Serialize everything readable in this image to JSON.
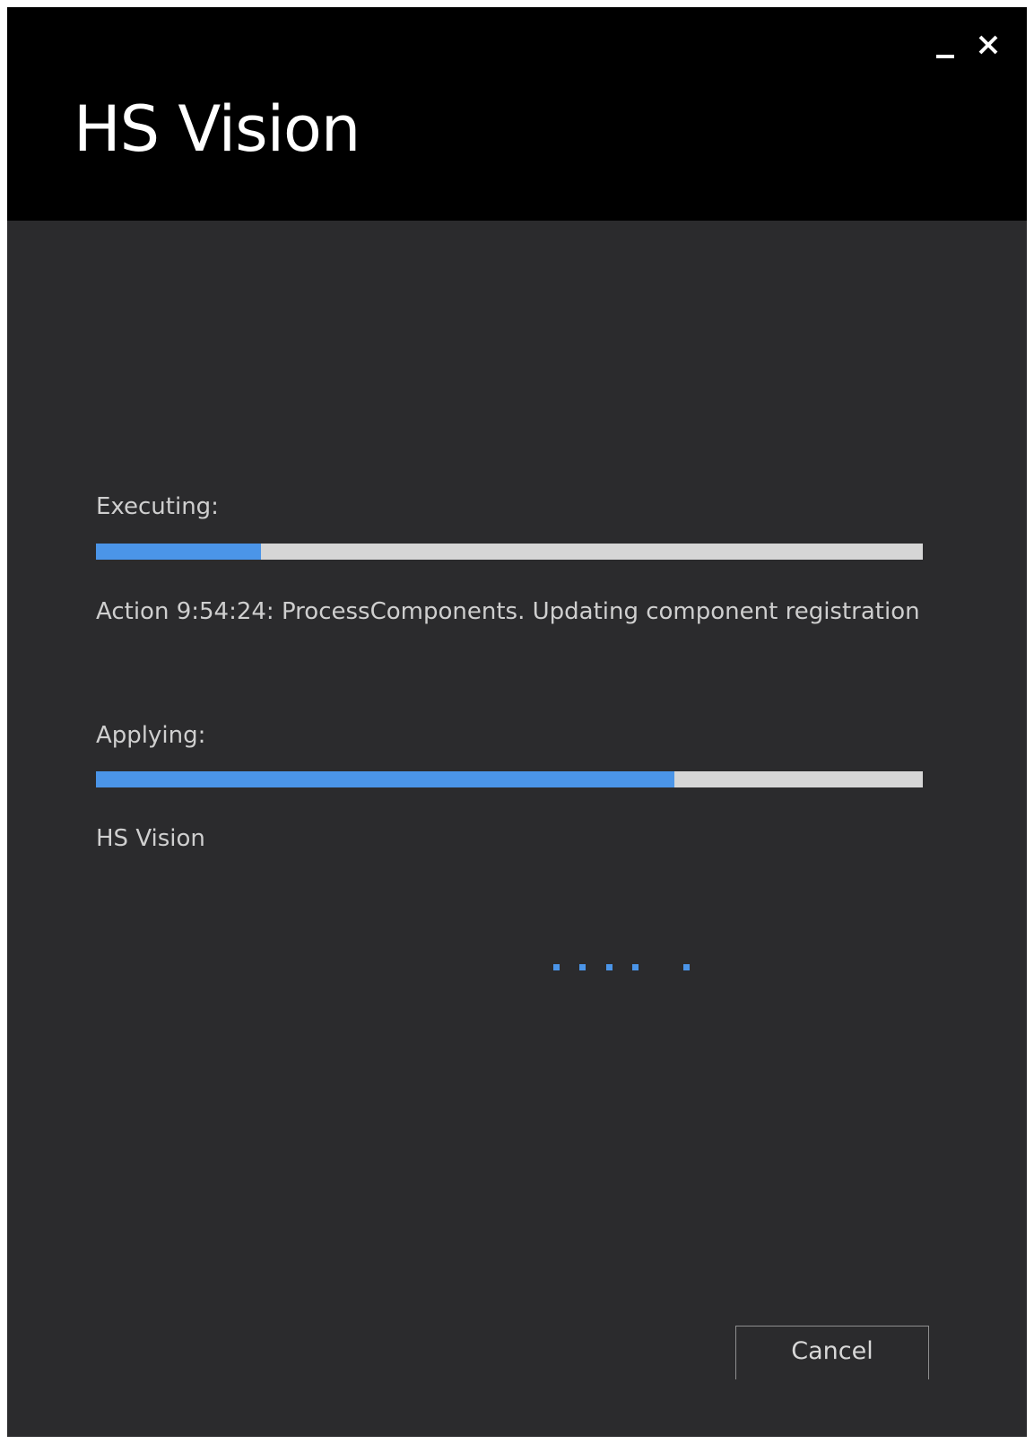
{
  "window": {
    "title": "HS Vision",
    "minimize_icon": "minimize-icon",
    "close_icon": "close-icon"
  },
  "executing": {
    "label": "Executing:",
    "progress_fraction": 0.2,
    "action_text": "Action 9:54:24: ProcessComponents. Updating component registration"
  },
  "applying": {
    "label": "Applying:",
    "progress_fraction": 0.7,
    "detail_text": "HS Vision"
  },
  "spinner": {
    "dot_count": 5
  },
  "buttons": {
    "cancel_label": "Cancel"
  },
  "colors": {
    "titlebar_bg": "#000000",
    "body_bg": "#2b2b2d",
    "accent": "#4b95e8",
    "track": "#d6d6d6",
    "text": "#cfcfcf"
  }
}
